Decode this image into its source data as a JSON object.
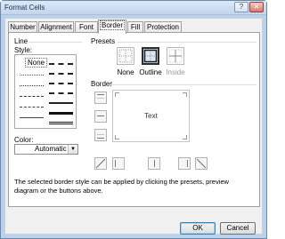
{
  "window": {
    "title": "Format Cells",
    "help_glyph": "?",
    "close_glyph": "✕"
  },
  "tabs": [
    {
      "label": "Number"
    },
    {
      "label": "Alignment"
    },
    {
      "label": "Font"
    },
    {
      "label": "Border",
      "active": true
    },
    {
      "label": "Fill"
    },
    {
      "label": "Protection"
    }
  ],
  "line_group": {
    "title": "Line",
    "style_label": "Style:",
    "none_label": "None",
    "color_label": "Color:",
    "color_value": "Automatic",
    "dropdown_glyph": "▼"
  },
  "presets": {
    "title": "Presets",
    "items": [
      {
        "label": "None"
      },
      {
        "label": "Outline"
      },
      {
        "label": "Inside",
        "disabled": true
      }
    ]
  },
  "border_group": {
    "title": "Border",
    "preview_text": "Text"
  },
  "description": "The selected border style can be applied by clicking the presets, preview diagram or the buttons above.",
  "buttons": {
    "ok": "OK",
    "cancel": "Cancel"
  },
  "colors": {
    "titlebar": "#c3d6ee",
    "dialog_bg": "#f0f0f0",
    "selected_preset": "#d9e9f7"
  }
}
